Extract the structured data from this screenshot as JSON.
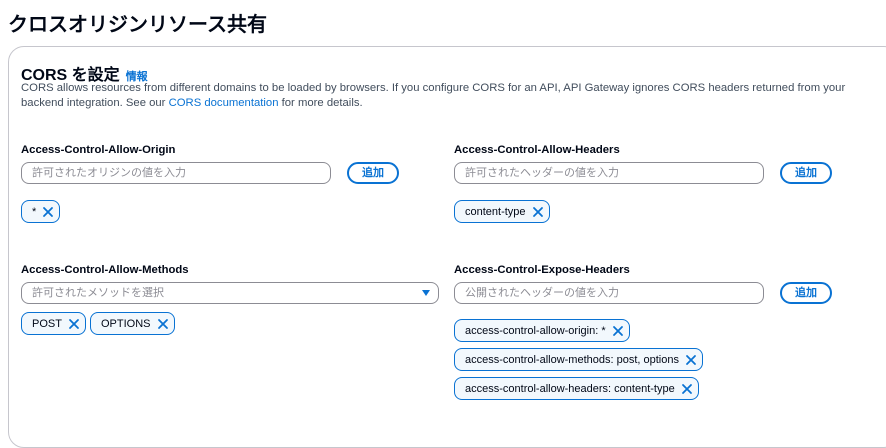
{
  "page": {
    "title": "クロスオリジンリソース共有"
  },
  "cors": {
    "title": "CORS を設定",
    "info_label": "情報",
    "description_prefix": "CORS allows resources from different domains to be loaded by browsers. If you configure CORS for an API, API Gateway ignores CORS headers returned from your backend integration. See our ",
    "doc_link": "CORS documentation",
    "description_suffix": " for more details."
  },
  "allow_origin": {
    "label": "Access-Control-Allow-Origin",
    "placeholder": "許可されたオリジンの値を入力",
    "add_label": "追加",
    "tokens": [
      "*"
    ]
  },
  "allow_headers": {
    "label": "Access-Control-Allow-Headers",
    "placeholder": "許可されたヘッダーの値を入力",
    "add_label": "追加",
    "tokens": [
      "content-type"
    ]
  },
  "allow_methods": {
    "label": "Access-Control-Allow-Methods",
    "placeholder": "許可されたメソッドを選択",
    "tokens": [
      "POST",
      "OPTIONS"
    ]
  },
  "expose_headers": {
    "label": "Access-Control-Expose-Headers",
    "placeholder": "公開されたヘッダーの値を入力",
    "add_label": "追加",
    "tokens": [
      "access-control-allow-origin: *",
      "access-control-allow-methods: post, options",
      "access-control-allow-headers: content-type"
    ]
  },
  "icons": {
    "remove": "close-icon",
    "dropdown": "caret-down-icon"
  },
  "colors": {
    "accent": "#0972d3",
    "token_bg": "#f2f8fd",
    "border": "#8c8c94"
  }
}
